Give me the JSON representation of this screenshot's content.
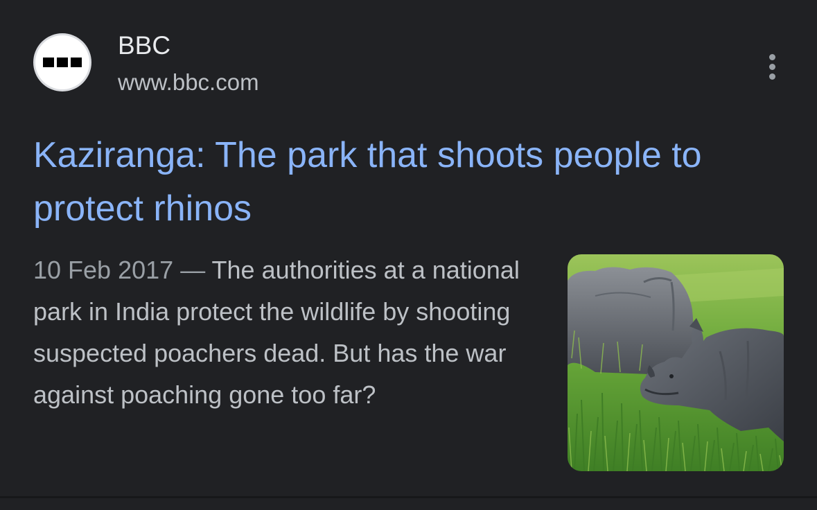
{
  "result": {
    "source": {
      "name": "BBC",
      "url": "www.bbc.com",
      "favicon_icon": "bbc-logo-icon"
    },
    "menu_icon": "more-vert-icon",
    "title": "Kaziranga: The park that shoots people to protect rhinos",
    "date": "10 Feb 2017",
    "separator": "—",
    "snippet": "The authorities at a national park in India protect the wildlife by shooting suspected poachers dead. But has the war against poaching gone too far?",
    "thumbnail_icon": "rhinos-thumbnail"
  },
  "colors": {
    "background": "#202124",
    "title_link": "#8ab4f8",
    "primary_text": "#e8eaed",
    "secondary_text": "#bdc1c6",
    "muted_text": "#9aa0a6"
  }
}
